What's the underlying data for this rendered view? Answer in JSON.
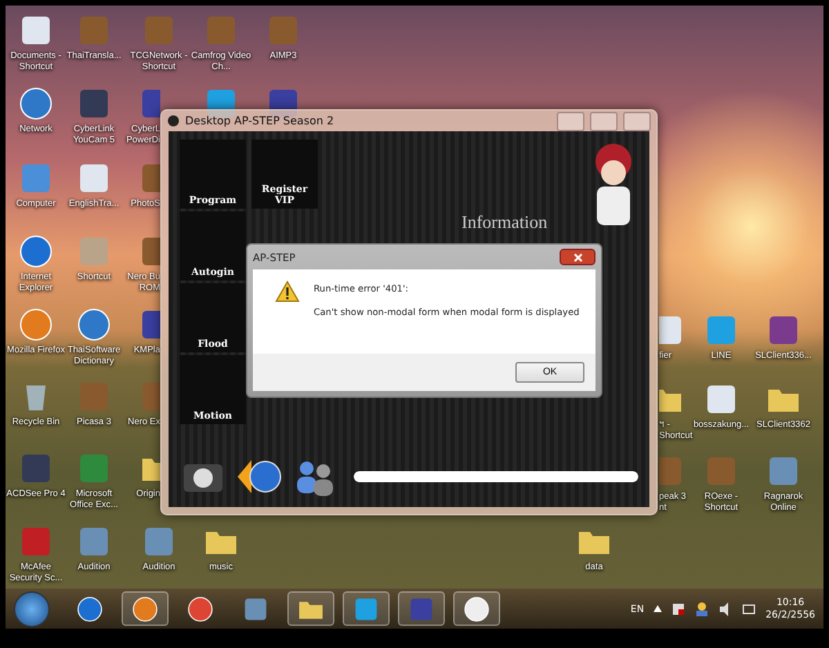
{
  "desktop_icons": [
    {
      "kind": "document",
      "label": "Documents - Shortcut"
    },
    {
      "kind": "globe",
      "label": "Network"
    },
    {
      "kind": "computer",
      "label": "Computer"
    },
    {
      "kind": "browser",
      "label": "Internet Explorer"
    },
    {
      "kind": "fox",
      "label": "Mozilla Firefox"
    },
    {
      "kind": "trash",
      "label": "Recycle Bin"
    },
    {
      "kind": "camera",
      "label": "ACDSee Pro 4"
    },
    {
      "kind": "shield",
      "label": "McAfee Security Sc..."
    },
    {
      "kind": "app",
      "label": "ThaiTransla..."
    },
    {
      "kind": "camera",
      "label": "CyberLink YouCam 5"
    },
    {
      "kind": "document",
      "label": "EnglishTra..."
    },
    {
      "kind": "photo",
      "label": "Shortcut"
    },
    {
      "kind": "globe",
      "label": "ThaiSoftware Dictionary"
    },
    {
      "kind": "app",
      "label": "Picasa 3"
    },
    {
      "kind": "sheet",
      "label": "Microsoft Office Exc..."
    },
    {
      "kind": "person",
      "label": "Audition"
    },
    {
      "kind": "app",
      "label": "TCGNetwork - Shortcut"
    },
    {
      "kind": "player",
      "label": "CyberL PowerDi"
    },
    {
      "kind": "app",
      "label": "PhotoS"
    },
    {
      "kind": "app",
      "label": "Nero Bu ROM"
    },
    {
      "kind": "player",
      "label": "KMPla"
    },
    {
      "kind": "app",
      "label": "Nero Ex"
    },
    {
      "kind": "folder",
      "label": "Origin"
    },
    {
      "kind": "person",
      "label": "Audition"
    },
    {
      "kind": "app",
      "label": "Camfrog Video Ch..."
    },
    {
      "kind": "chat"
    },
    {
      "kind": "folder",
      "label": "music"
    },
    {
      "kind": "app",
      "label": "AIMP3"
    },
    {
      "kind": "player"
    },
    {
      "kind": "document",
      "label": "fier"
    },
    {
      "kind": "folder",
      "label": "ฯ - Shortcut"
    },
    {
      "kind": "app",
      "label": "peak 3 nt"
    },
    {
      "kind": "chat",
      "label": "LINE"
    },
    {
      "kind": "document",
      "label": "bosszakung..."
    },
    {
      "kind": "app",
      "label": "ROexe - Shortcut"
    },
    {
      "kind": "archive",
      "label": "SLClient336..."
    },
    {
      "kind": "folder",
      "label": "SLClient3362"
    },
    {
      "kind": "person",
      "label": "Ragnarok Online"
    },
    {
      "kind": "folder",
      "label": "data"
    }
  ],
  "app_window": {
    "title": "Desktop AP-STEP Season 2",
    "heading": "Information",
    "tiles": [
      {
        "label": "Program"
      },
      {
        "label": "Register VIP"
      },
      {
        "label": "Autogin"
      },
      {
        "label": "Flood"
      },
      {
        "label": "Motion"
      }
    ],
    "progress": {
      "level": 1
    }
  },
  "dialog": {
    "title": "AP-STEP",
    "error": "Run-time error '401':",
    "message": "Can't show non-modal form when modal form is displayed",
    "button": "OK"
  },
  "taskbar": {
    "items": [
      {
        "kind": "browser",
        "running": false
      },
      {
        "kind": "fox",
        "running": true
      },
      {
        "kind": "chrome",
        "running": false
      },
      {
        "kind": "person",
        "running": false
      },
      {
        "kind": "folder",
        "running": true
      },
      {
        "kind": "chat",
        "running": true
      },
      {
        "kind": "player",
        "running": true
      },
      {
        "kind": "round",
        "running": true
      }
    ],
    "language": "EN",
    "time": "10:16",
    "date": "26/2/2556"
  }
}
